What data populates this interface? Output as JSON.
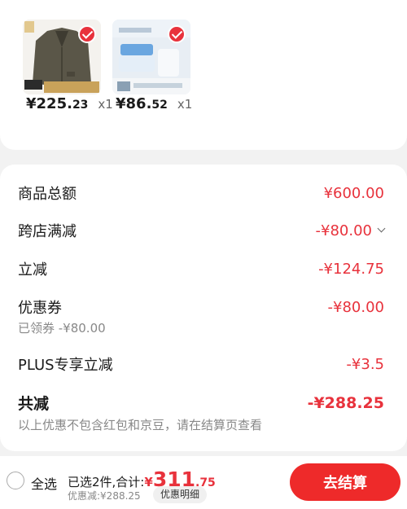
{
  "products": [
    {
      "image": "blazer-product-image",
      "selected": true,
      "price_main": "¥225.",
      "price_decimal": "23",
      "quantity": "x1"
    },
    {
      "image": "skincare-product-image",
      "selected": true,
      "price_main": "¥86.",
      "price_decimal": "52",
      "quantity": "x1"
    }
  ],
  "summary": {
    "goods_total_label": "商品总额",
    "goods_total_value": "¥600.00",
    "cross_store_label": "跨店满减",
    "cross_store_value": "-¥80.00",
    "instant_discount_label": "立减",
    "instant_discount_value": "-¥124.75",
    "coupon_label": "优惠券",
    "coupon_value": "-¥80.00",
    "coupon_sub": "已领券 -¥80.00",
    "plus_label": "PLUS专享立减",
    "plus_value": "-¥3.5",
    "total_label": "共减",
    "total_value": "-¥288.25",
    "note": "以上优惠不包含红包和京豆，请在结算页查看"
  },
  "bottom_bar": {
    "select_all_label": "全选",
    "selected_count_text": "已选2件,合计:",
    "total_symbol": "¥",
    "total_int": "311",
    "total_dec": ".75",
    "discount_text": "优惠减:¥288.25",
    "detail_button_label": "优惠明细",
    "checkout_button_label": "去结算"
  },
  "colors": {
    "accent": "#e8323c",
    "checkout": "#ee2a2a"
  }
}
